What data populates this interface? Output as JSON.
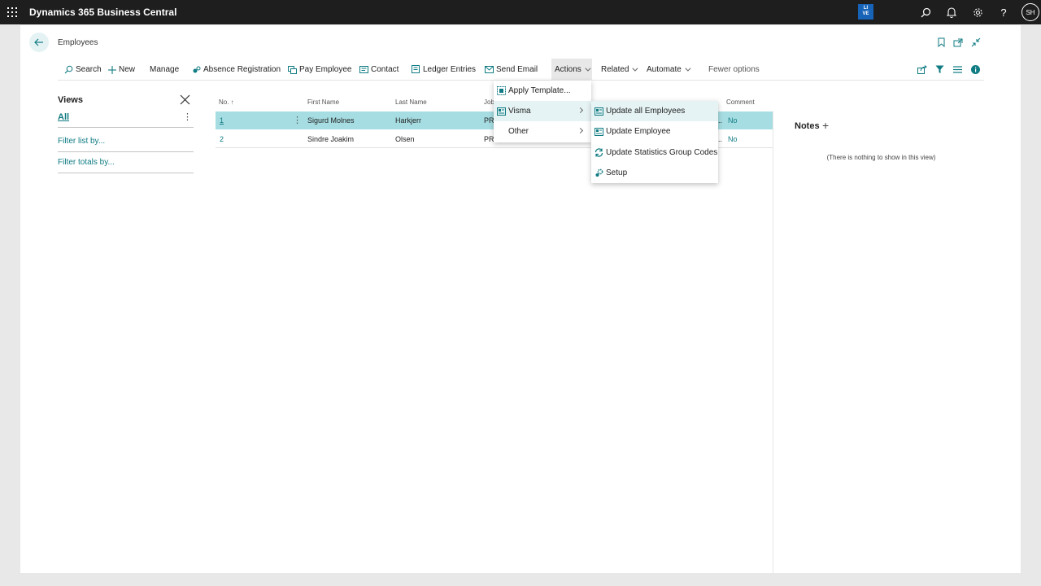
{
  "app": {
    "title": "Dynamics 365 Business Central",
    "env_badge_top": "LI",
    "env_badge_bottom": "VE",
    "user_initials": "SH"
  },
  "page": {
    "breadcrumb": "Employees"
  },
  "actionbar": {
    "search": "Search",
    "new": "New",
    "manage": "Manage",
    "absence_registration": "Absence Registration",
    "pay_employee": "Pay Employee",
    "contact": "Contact",
    "ledger_entries": "Ledger Entries",
    "send_email": "Send Email",
    "actions": "Actions",
    "related": "Related",
    "automate": "Automate",
    "fewer_options": "Fewer options"
  },
  "views": {
    "title": "Views",
    "all": "All",
    "more": "⋮",
    "filter_list": "Filter list by...",
    "filter_totals": "Filter totals by..."
  },
  "list": {
    "columns": {
      "no": "No. ↑",
      "first_name": "First Name",
      "last_name": "Last Name",
      "job": "Job",
      "comment": "Comment"
    },
    "rows": [
      {
        "no": "1",
        "first_name": "Sigurd Molnes",
        "last_name": "Harkjerr",
        "job": "PR",
        "status_trunc": "..",
        "comment": "No",
        "menu": "⋮"
      },
      {
        "no": "2",
        "first_name": "Sindre Joakim",
        "last_name": "Olsen",
        "job": "PR",
        "status_trunc": "..",
        "comment": "No"
      }
    ]
  },
  "notes": {
    "title": "Notes",
    "add": "+",
    "empty": "(There is nothing to show in this view)"
  },
  "actions_menu": {
    "items": [
      "Apply Template...",
      "Visma",
      "Other"
    ]
  },
  "visma_menu": {
    "items": [
      "Update all Employees",
      "Update Employee",
      "Update Statistics Group Codes",
      "Setup"
    ]
  },
  "colors": {
    "accent": "#0f7b82",
    "selected_row": "#a6dde2",
    "topbar": "#1e1e1e"
  }
}
